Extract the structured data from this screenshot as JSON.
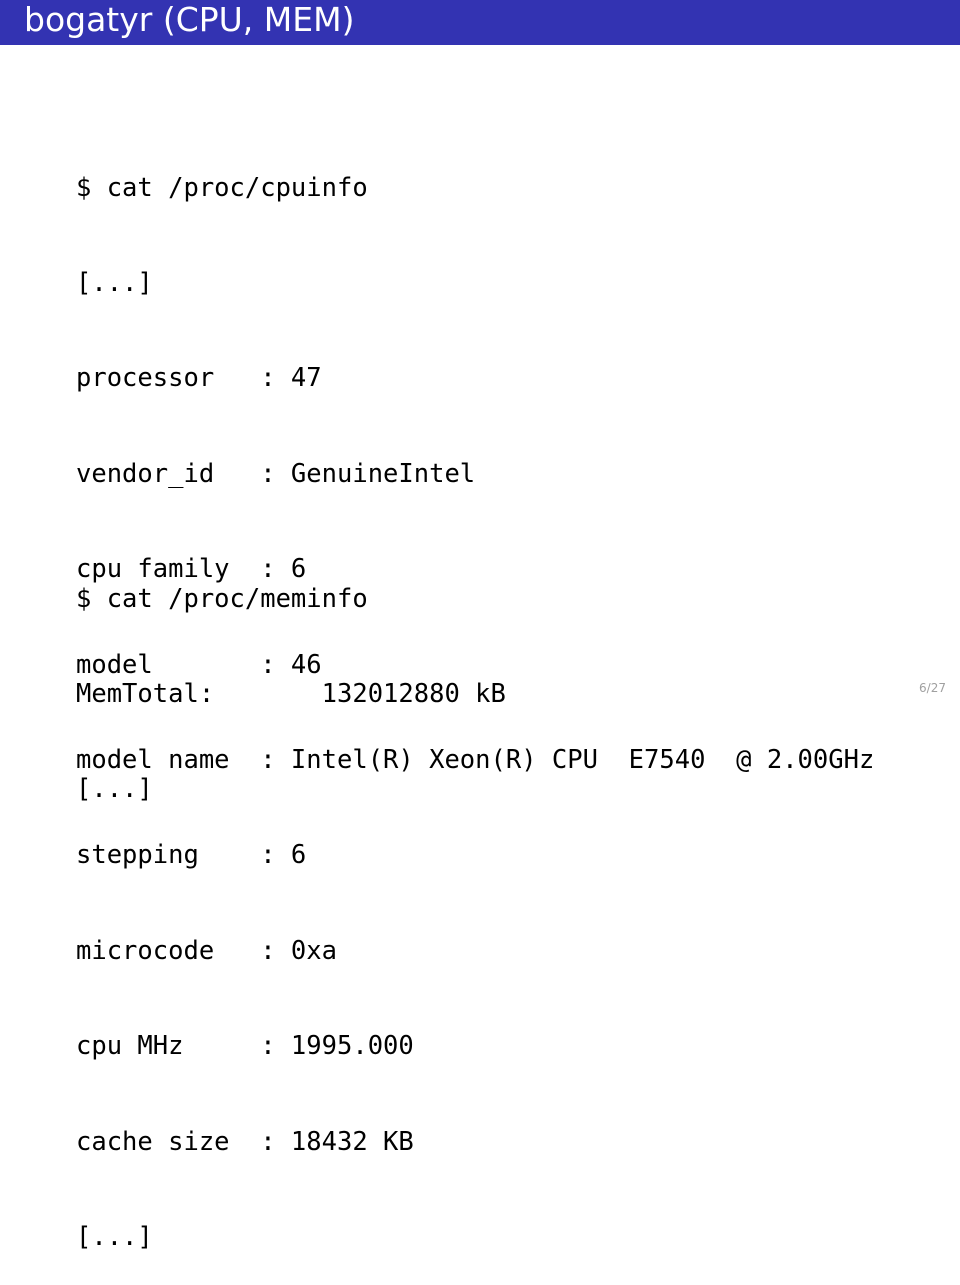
{
  "slide": {
    "title": "bogatyr (CPU, MEM)",
    "header_color": "#3333b2",
    "page_number": "6/27"
  },
  "cpuinfo": {
    "lines": [
      "$ cat /proc/cpuinfo",
      "[...]",
      "processor   : 47",
      "vendor_id   : GenuineIntel",
      "cpu family  : 6",
      "model       : 46",
      "model name  : Intel(R) Xeon(R) CPU  E7540  @ 2.00GHz",
      "stepping    : 6",
      "microcode   : 0xa",
      "cpu MHz     : 1995.000",
      "cache size  : 18432 KB",
      "[...]"
    ]
  },
  "meminfo": {
    "lines": [
      "$ cat /proc/meminfo",
      "MemTotal:       132012880 kB",
      "[...]"
    ]
  }
}
